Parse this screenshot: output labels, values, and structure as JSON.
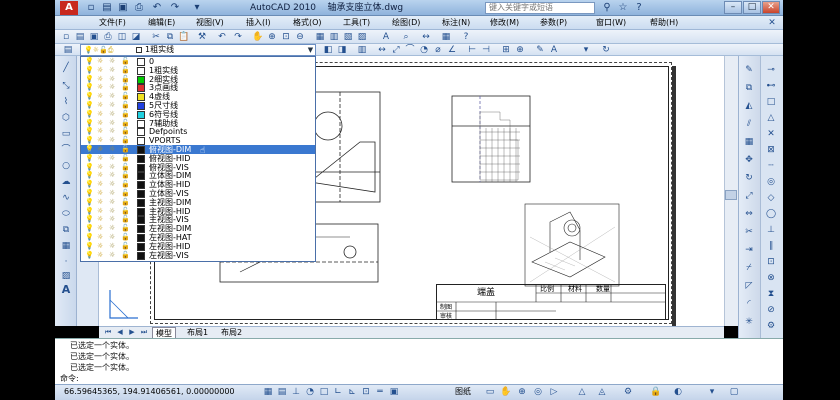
{
  "app": {
    "title": "AutoCAD 2010",
    "file": "轴承支座立体.dwg",
    "search_placeholder": "键入关键字或短语",
    "logo": "A"
  },
  "menu": [
    "文件(F)",
    "编辑(E)",
    "视图(V)",
    "插入(I)",
    "格式(O)",
    "工具(T)",
    "绘图(D)",
    "标注(N)",
    "修改(M)",
    "参数(P)",
    "窗口(W)",
    "帮助(H)"
  ],
  "layer_combo": {
    "current": "1粗实线"
  },
  "layers": [
    {
      "name": "0",
      "color": "#ffffff"
    },
    {
      "name": "1粗实线",
      "color": "#ffffff"
    },
    {
      "name": "2细实线",
      "color": "#00cc00"
    },
    {
      "name": "3点画线",
      "color": "#e03030"
    },
    {
      "name": "4虚线",
      "color": "#f0e020"
    },
    {
      "name": "5尺寸线",
      "color": "#2040e0"
    },
    {
      "name": "6符号线",
      "color": "#20d0e0"
    },
    {
      "name": "7辅助线",
      "color": "#ffffff"
    },
    {
      "name": "Defpoints",
      "color": "#ffffff"
    },
    {
      "name": "VPORTS",
      "color": "#ffffff"
    },
    {
      "name": "俯视图-DIM",
      "color": "#111111",
      "selected": true
    },
    {
      "name": "俯视图-HID",
      "color": "#111111"
    },
    {
      "name": "俯视图-VIS",
      "color": "#111111"
    },
    {
      "name": "立体图-DIM",
      "color": "#111111"
    },
    {
      "name": "立体图-HID",
      "color": "#111111"
    },
    {
      "name": "立体图-VIS",
      "color": "#111111"
    },
    {
      "name": "主视图-DIM",
      "color": "#111111"
    },
    {
      "name": "主视图-HID",
      "color": "#111111"
    },
    {
      "name": "主视图-VIS",
      "color": "#111111"
    },
    {
      "name": "左视图-DIM",
      "color": "#111111"
    },
    {
      "name": "左视图-HAT",
      "color": "#111111"
    },
    {
      "name": "左视图-HID",
      "color": "#111111"
    },
    {
      "name": "左视图-VIS",
      "color": "#111111"
    }
  ],
  "tabs": [
    "模型",
    "布局1",
    "布局2"
  ],
  "command": {
    "history": [
      "已选定一个实体。",
      "已选定一个实体。",
      "已选定一个实体。"
    ],
    "prompt": "命令:"
  },
  "status": {
    "coords": "66.59645365,  194.91406561,  0.00000000",
    "mode_label": "图纸"
  },
  "title_block": {
    "name": "端盖",
    "ratio": "比例",
    "material": "材料",
    "quantity": "数量",
    "drawn": "制图",
    "checked": "审核"
  },
  "colors": {
    "selection": "#3a78d0",
    "titlebar": "#9fbde3"
  }
}
